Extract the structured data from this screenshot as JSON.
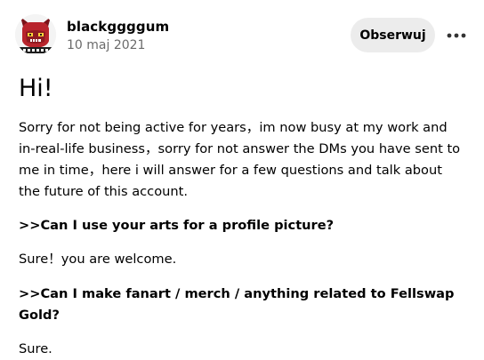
{
  "post": {
    "author": "blackggggum",
    "date": "10 maj 2021",
    "follow_label": "Obserwuj",
    "more_icon": "more-horizontal-icon",
    "title": "Hi!",
    "paragraphs": [
      "Sorry for not being active for years，im now busy at my work and in-real-life business，sorry for not answer the DMs you have sent to me in time，here i will answer for a few questions and talk about the future of this account.",
      ">>Can I use your arts for a profile picture?",
      "Sure！you are welcome.",
      ">>Can I make fanart / merch / anything related to Fellswap Gold?",
      "Sure."
    ]
  },
  "colors": {
    "background": "#ffffff",
    "button_bg": "#ececec",
    "muted_text": "#6b6b6b",
    "avatar_red": "#b8242c"
  }
}
